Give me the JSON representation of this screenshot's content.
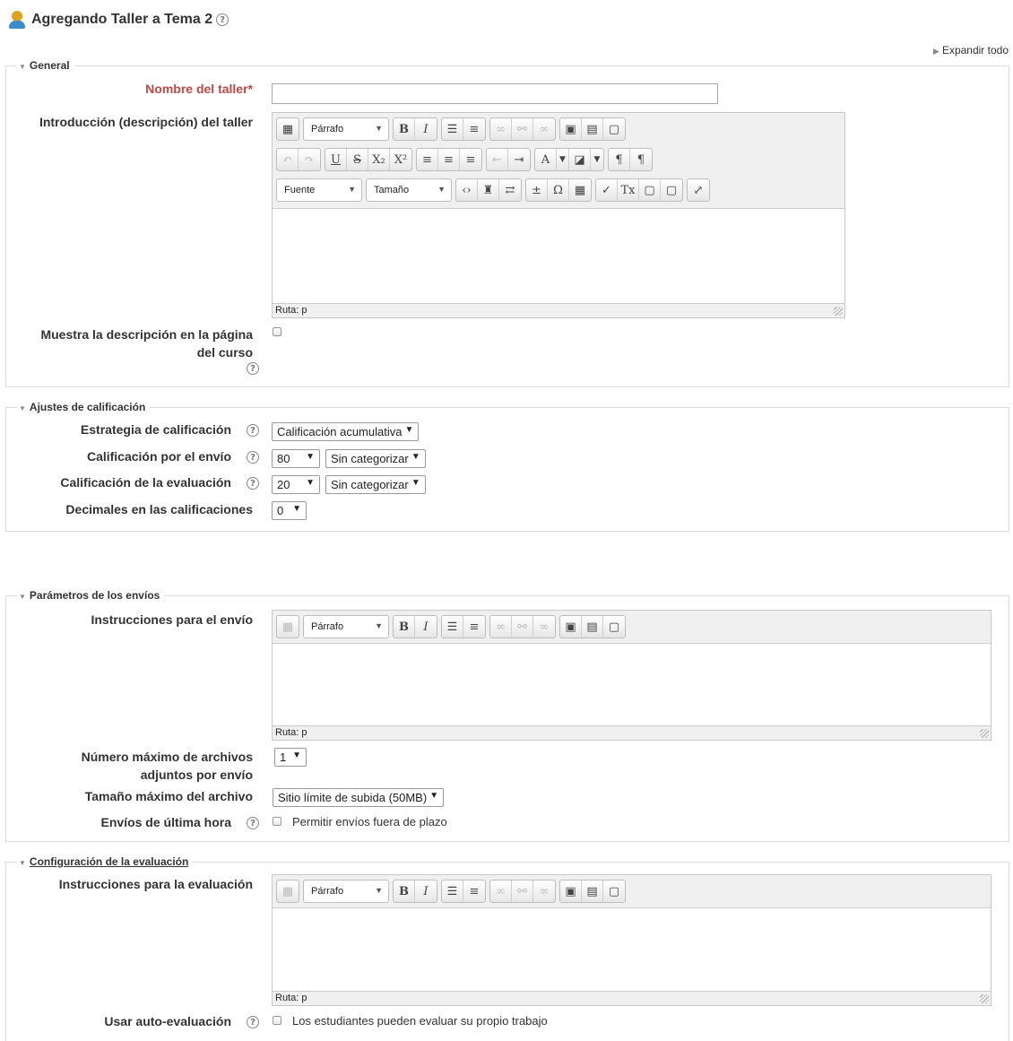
{
  "header": {
    "title": "Agregando Taller a Tema 2",
    "expand_all": "Expandir todo"
  },
  "general": {
    "legend": "General",
    "name_label": "Nombre del taller*",
    "intro_label": "Introducción (descripción) del taller",
    "show_desc_label_1": "Muestra la descripción en la página",
    "show_desc_label_2": "del curso"
  },
  "editor": {
    "format": "Párrafo",
    "font": "Fuente",
    "size": "Tamaño",
    "path": "Ruta: p"
  },
  "grading": {
    "legend": "Ajustes de calificación",
    "strategy_label": "Estrategia de calificación",
    "strategy_value": "Calificación acumulativa",
    "submission_label": "Calificación por el envío",
    "submission_value": "80",
    "submission_cat": "Sin categorizar",
    "assessment_label": "Calificación de la evaluación",
    "assessment_value": "20",
    "assessment_cat": "Sin categorizar",
    "decimals_label": "Decimales en las calificaciones",
    "decimals_value": "0"
  },
  "submission": {
    "legend": "Parámetros de los envíos",
    "instructions_label": "Instrucciones para el envío",
    "max_files_label_1": "Número máximo de archivos",
    "max_files_label_2": "adjuntos por envío",
    "max_files_value": "1",
    "max_size_label": "Tamaño máximo del archivo",
    "max_size_value": "Sitio límite de subida (50MB)",
    "late_label": "Envíos de última hora",
    "late_checkbox": "Permitir envíos fuera de plazo"
  },
  "assessment": {
    "legend": "Configuración de la evaluación",
    "instructions_label": "Instrucciones para la evaluación",
    "self_label": "Usar auto-evaluación",
    "self_checkbox": "Los estudiantes pueden evaluar su propio trabajo"
  }
}
